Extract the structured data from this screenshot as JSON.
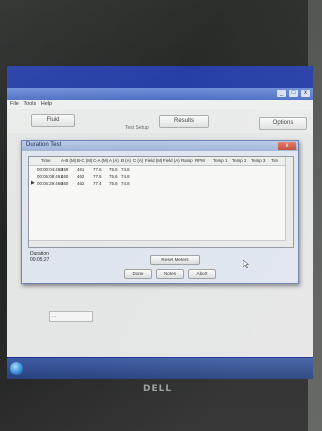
{
  "app": {
    "menu": [
      "File",
      "Tools",
      "Help"
    ],
    "toolbar": {
      "left_button": "Fluid",
      "center_label": "Test Setup",
      "results_button": "Results",
      "options_button": "Options"
    },
    "title_buttons": [
      "_",
      "□",
      "x"
    ]
  },
  "dialog": {
    "title": "Duration Test",
    "close_label": "x",
    "columns": [
      "Time",
      "A-B (M)",
      "B-C (M)",
      "C-A (M)",
      "A (A)",
      "B (A)",
      "C (A)",
      "Field (M)",
      "Field (A)",
      "Ramp",
      "RPM",
      "Temp 1",
      "Temp 2",
      "Temp 3",
      "Tim"
    ],
    "rows": [
      {
        "marker": "",
        "cells": [
          "00:00:04:460",
          "459",
          "461",
          "77.6",
          "75.6",
          "74.8"
        ]
      },
      {
        "marker": "",
        "cells": [
          "00:05:08:461",
          "460",
          "462",
          "77.5",
          "75.6",
          "74.8"
        ]
      },
      {
        "marker": "▶",
        "cells": [
          "00:05:29:460",
          "460",
          "462",
          "77.4",
          "75.6",
          "74.8"
        ]
      }
    ],
    "duration_label": "Duration",
    "duration_value": "00:05:27",
    "reset_button": "Reset Meters",
    "bottom_buttons": [
      "Done",
      "Notes",
      "Abort"
    ]
  },
  "body_field_text": "...",
  "monitor_brand": "DELL",
  "colors": {
    "desktop": "#2740a8",
    "dialog_titlebar": "#b8c9e6",
    "close_button": "#c24a35"
  }
}
